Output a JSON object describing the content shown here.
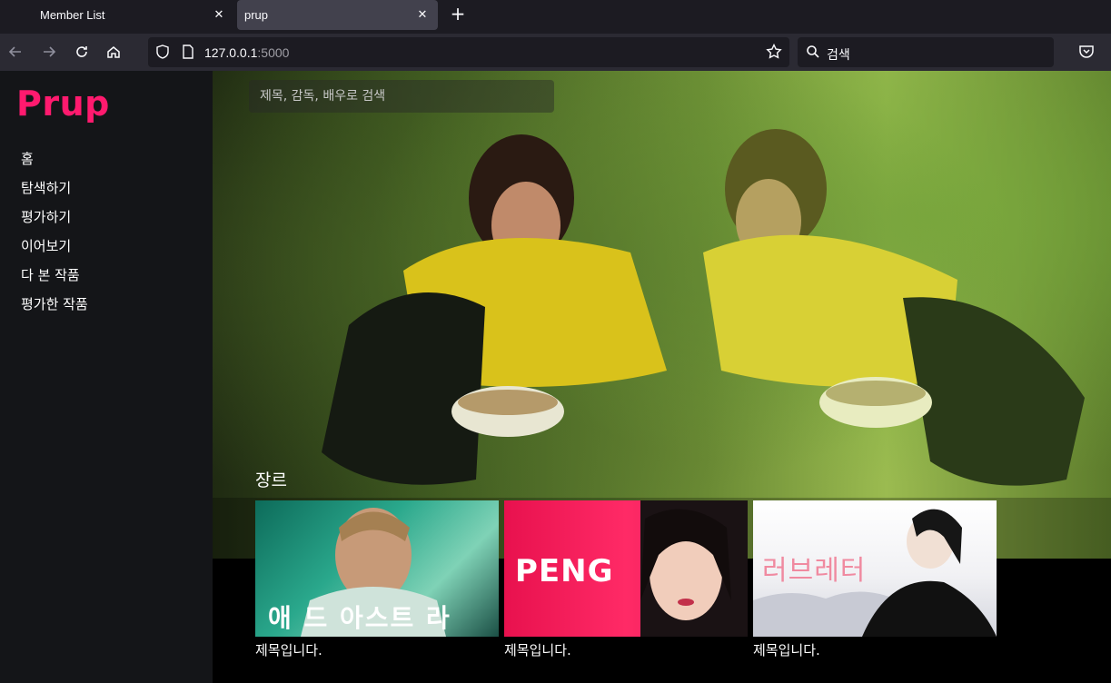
{
  "browser": {
    "tabs": [
      {
        "label": "Member List"
      },
      {
        "label": "prup"
      }
    ],
    "url_host": "127.0.0.1",
    "url_port": ":5000",
    "search_placeholder": "검색"
  },
  "sidebar": {
    "logo": "Prup",
    "menu": [
      {
        "label": "홈"
      },
      {
        "label": "탐색하기"
      },
      {
        "label": "평가하기"
      },
      {
        "label": "이어보기"
      },
      {
        "label": "다 본 작품"
      },
      {
        "label": "평가한 작품"
      }
    ]
  },
  "main": {
    "search_placeholder": "제목, 감독, 배우로 검색",
    "genre_heading": "장르",
    "cards": [
      {
        "title": "제목입니다.",
        "poster_text": "애 드 아스트 라"
      },
      {
        "title": "제목입니다.",
        "poster_text": "PENG"
      },
      {
        "title": "제목입니다.",
        "poster_text": "러브레터"
      }
    ]
  },
  "colors": {
    "brand": "#ff1a6e",
    "sidebar_bg": "#141518",
    "chrome_bg": "#2b2a33"
  }
}
